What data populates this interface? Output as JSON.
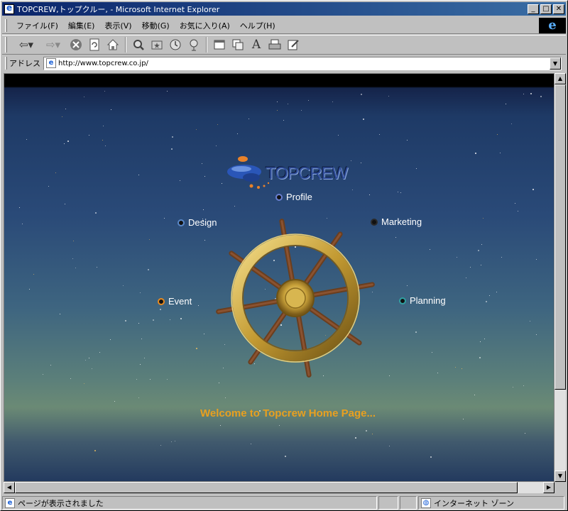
{
  "window": {
    "title": "TOPCREW,トップクルー, - Microsoft Internet Explorer",
    "minimize_glyph": "_",
    "maximize_glyph": "□",
    "close_glyph": "✕"
  },
  "menubar": {
    "items": [
      "ファイル(F)",
      "編集(E)",
      "表示(V)",
      "移動(G)",
      "お気に入り(A)",
      "ヘルプ(H)"
    ],
    "logo_glyph": "e"
  },
  "toolbar": {
    "icons": [
      "back-icon",
      "forward-icon",
      "stop-icon",
      "refresh-icon",
      "home-icon",
      "search-icon",
      "favorites-icon",
      "history-icon",
      "channels-icon",
      "fullscreen-icon",
      "mail-icon",
      "font-icon",
      "print-icon",
      "edit-icon"
    ]
  },
  "addressbar": {
    "label": "アドレス",
    "url": "http://www.topcrew.co.jp/"
  },
  "page": {
    "logo_text": "TOPCREW",
    "nav": [
      {
        "label": "Profile",
        "dot_color": "#6a7fd0"
      },
      {
        "label": "Design",
        "dot_color": "#5a88c8"
      },
      {
        "label": "Marketing",
        "dot_color": "#2a2a2a"
      },
      {
        "label": "Event",
        "dot_color": "#e88a20"
      },
      {
        "label": "Planning",
        "dot_color": "#30a0a0"
      }
    ],
    "welcome": "Welcome to Topcrew Home Page...",
    "accent_color": "#e8a020",
    "background_colors": [
      "#15244a",
      "#2a4a78",
      "#6b8a75",
      "#22395e"
    ]
  },
  "statusbar": {
    "status_text": "ページが表示されました",
    "zone_text": "インターネット ゾーン"
  }
}
